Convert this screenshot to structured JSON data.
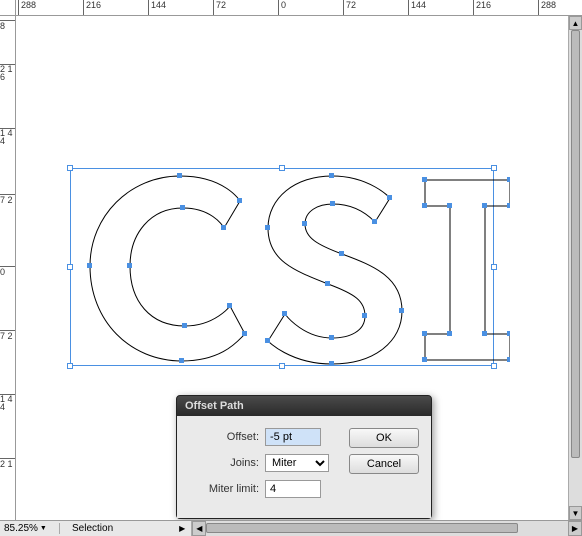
{
  "ruler_top": [
    "288",
    "216",
    "144",
    "72",
    "0",
    "72",
    "144",
    "216",
    "288"
  ],
  "ruler_left": [
    "8",
    "2 1 6",
    "1 4 4",
    "7 2",
    "0",
    "7 2",
    "1 4 4",
    "2 1"
  ],
  "artwork_text": "CSI",
  "dialog": {
    "title": "Offset Path",
    "offset_label": "Offset:",
    "offset_value": "-5 pt",
    "joins_label": "Joins:",
    "joins_value": "Miter",
    "miter_label": "Miter limit:",
    "miter_value": "4",
    "ok": "OK",
    "cancel": "Cancel"
  },
  "status": {
    "zoom": "85.25%",
    "tool": "Selection"
  }
}
